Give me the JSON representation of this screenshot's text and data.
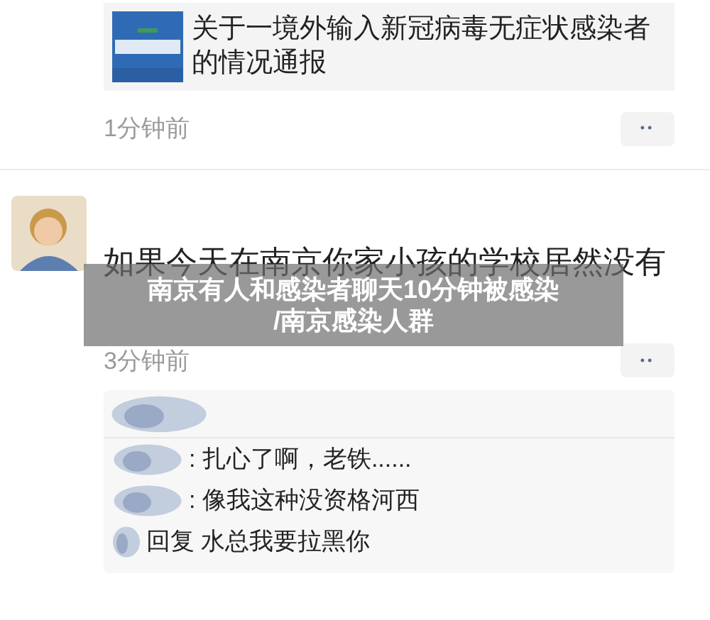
{
  "posts": [
    {
      "link": {
        "title": "关于一境外输入新冠病毒无症状感染者的情况通报"
      },
      "time": "1分钟前",
      "more": "••"
    },
    {
      "text": "如果今天在南京你家小孩的学校居然没有",
      "time": "3分钟前",
      "more": "••",
      "comments": [
        ": 扎心了啊，老铁......",
        ": 像我这种没资格河西",
        "回复 水总我要拉黑你"
      ]
    }
  ],
  "caption": [
    "南京有人和感染者聊天10分钟被感染",
    "/南京感染人群"
  ]
}
